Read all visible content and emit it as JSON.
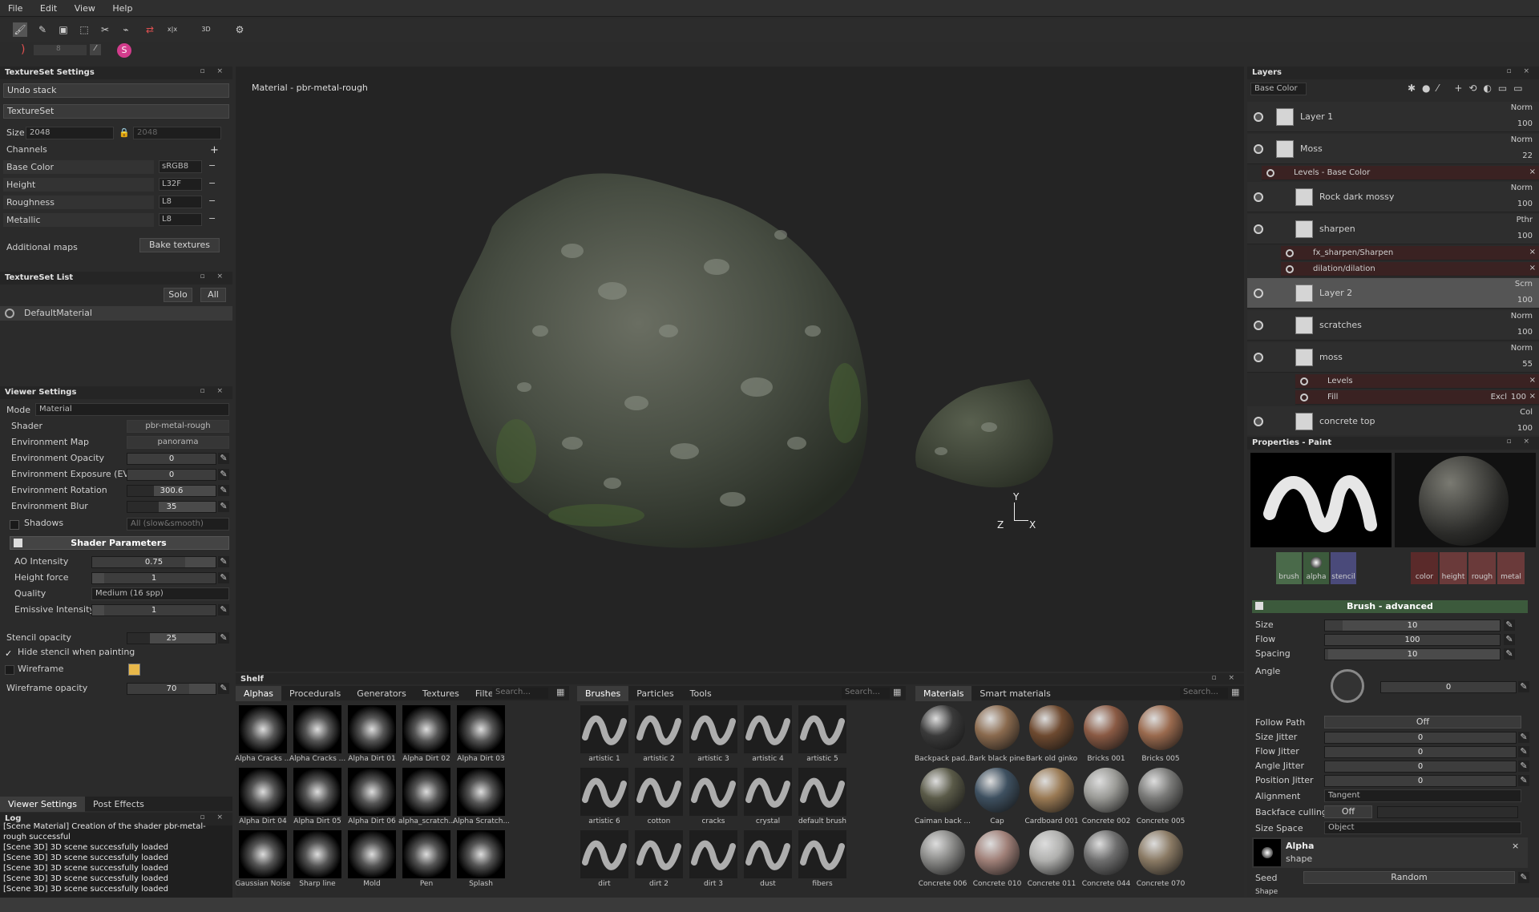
{
  "menu": [
    "File",
    "Edit",
    "View",
    "Help"
  ],
  "toolbar": {
    "tools": [
      "↖",
      "🖌",
      "✎",
      "▣",
      "⬚",
      "✂",
      "⌁",
      "⬈",
      "⇄",
      "x|x",
      "⧉",
      "3D",
      "⬈",
      "⚙"
    ],
    "size_value": "8"
  },
  "textureset_settings": {
    "title": "TextureSet Settings",
    "undo": "Undo stack",
    "textureset": "TextureSet",
    "size_label": "Size",
    "size_value": "2048",
    "size_value2": "2048",
    "channels_label": "Channels",
    "channels": [
      {
        "name": "Base Color",
        "format": "sRGB8"
      },
      {
        "name": "Height",
        "format": "L32F"
      },
      {
        "name": "Roughness",
        "format": "L8"
      },
      {
        "name": "Metallic",
        "format": "L8"
      }
    ],
    "additional_maps": "Additional maps",
    "bake": "Bake textures"
  },
  "textureset_list": {
    "title": "TextureSet List",
    "solo": "Solo",
    "all": "All",
    "item": "DefaultMaterial"
  },
  "viewer_settings": {
    "title": "Viewer Settings",
    "mode_label": "Mode",
    "mode": "Material",
    "rows": [
      {
        "label": "Shader",
        "value": "pbr-metal-rough"
      },
      {
        "label": "Environment Map",
        "value": "panorama"
      }
    ],
    "sliders": [
      {
        "label": "Environment Opacity",
        "value": "0",
        "fill": 0
      },
      {
        "label": "Environment Exposure (EV)",
        "value": "0",
        "fill": 0
      },
      {
        "label": "Environment Rotation",
        "value": "300.6",
        "fill": 0.3
      },
      {
        "label": "Environment Blur",
        "value": "35",
        "fill": 0.35
      }
    ],
    "shadows_label": "Shadows",
    "shadows_value": "All (slow&smooth)",
    "shader_params": "Shader Parameters",
    "params": [
      {
        "label": "AO Intensity",
        "value": "0.75",
        "fill": 0.75
      },
      {
        "label": "Height force",
        "value": "1",
        "fill": 0.1
      }
    ],
    "quality_label": "Quality",
    "quality_value": "Medium (16 spp)",
    "emissive_label": "Emissive Intensity",
    "emissive_value": "1",
    "stencil_label": "Stencil opacity",
    "stencil_value": "25",
    "hide_stencil": "Hide stencil when painting",
    "wireframe": "Wireframe",
    "wire_opacity_label": "Wireframe opacity",
    "wire_opacity_value": "70",
    "tabs": [
      "Viewer Settings",
      "Post Effects"
    ]
  },
  "log": {
    "title": "Log",
    "lines": [
      "[Scene Material] Creation of the shader pbr-metal-",
      "rough successful",
      "[Scene 3D] 3D scene successfully loaded",
      "[Scene 3D] 3D scene successfully loaded",
      "[Scene 3D] 3D scene successfully loaded",
      "[Scene 3D] 3D scene successfully loaded",
      "[Scene 3D] 3D scene successfully loaded"
    ]
  },
  "viewport": {
    "label": "Material - pbr-metal-rough",
    "axes": {
      "x": "X",
      "y": "Y",
      "z": "Z"
    }
  },
  "shelf": {
    "title": "Shelf",
    "tabs1": [
      "Alphas",
      "Procedurals",
      "Generators",
      "Textures",
      "Filte"
    ],
    "search": "Search...",
    "alphas": [
      "Alpha Cracks ...",
      "Alpha Cracks ...",
      "Alpha Dirt 01",
      "Alpha Dirt 02",
      "Alpha Dirt 03",
      "Alpha Dirt 04",
      "Alpha Dirt 05",
      "Alpha Dirt 06",
      "alpha_scratch...",
      "Alpha Scratch...",
      "Gaussian Noise",
      "Sharp line",
      "Mold",
      "Pen",
      "Splash"
    ],
    "tabs2": [
      "Brushes",
      "Particles",
      "Tools"
    ],
    "brushes": [
      "artistic 1",
      "artistic 2",
      "artistic 3",
      "artistic 4",
      "artistic 5",
      "artistic 6",
      "cotton",
      "cracks",
      "crystal",
      "default brush",
      "dirt",
      "dirt 2",
      "dirt 3",
      "dust",
      "fibers"
    ],
    "tabs3": [
      "Materials",
      "Smart materials"
    ],
    "materials": [
      {
        "name": "Backpack pad...",
        "color": "#3a3a3a"
      },
      {
        "name": "Bark black pine",
        "color": "#8a6a4e"
      },
      {
        "name": "Bark old ginko",
        "color": "#6e4a30"
      },
      {
        "name": "Bricks 001",
        "color": "#8a5a44"
      },
      {
        "name": "Bricks 005",
        "color": "#9a6a4e"
      },
      {
        "name": "Caiman back ...",
        "color": "#5a5a48"
      },
      {
        "name": "Cap",
        "color": "#3e5060"
      },
      {
        "name": "Cardboard 001",
        "color": "#9a7a54"
      },
      {
        "name": "Concrete 002",
        "color": "#9a9a96"
      },
      {
        "name": "Concrete 005",
        "color": "#7a7a78"
      },
      {
        "name": "Concrete 006",
        "color": "#8a8a88"
      },
      {
        "name": "Concrete 010",
        "color": "#a08078"
      },
      {
        "name": "Concrete 011",
        "color": "#b0b0ae"
      },
      {
        "name": "Concrete 044",
        "color": "#6e6e6e"
      },
      {
        "name": "Concrete 070",
        "color": "#8a7a64"
      }
    ]
  },
  "layers": {
    "title": "Layers",
    "channel": "Base Color",
    "items": [
      {
        "name": "Layer 1",
        "mode": "Norm",
        "opacity": "100"
      },
      {
        "name": "Moss",
        "mode": "Norm",
        "opacity": "22"
      },
      {
        "name": "Levels - Base Color"
      },
      {
        "name": "Rock dark mossy",
        "mode": "Norm",
        "opacity": "100"
      },
      {
        "name": "sharpen",
        "mode": "Pthr",
        "opacity": "100"
      },
      {
        "name": "fx_sharpen/Sharpen"
      },
      {
        "name": "dilation/dilation"
      },
      {
        "name": "Layer 2",
        "mode": "Scrn",
        "opacity": "100"
      },
      {
        "name": "scratches",
        "mode": "Norm",
        "opacity": "100"
      },
      {
        "name": "moss",
        "mode": "Norm",
        "opacity": "55"
      },
      {
        "name": "Levels"
      },
      {
        "name": "Fill",
        "mode": "Excl",
        "opacity": "100"
      },
      {
        "name": "concrete top",
        "mode": "Col",
        "opacity": "100"
      }
    ]
  },
  "properties": {
    "title": "Properties - Paint",
    "slots": [
      "brush",
      "alpha",
      "stencil"
    ],
    "channels": [
      "color",
      "height",
      "rough",
      "metal"
    ],
    "section": "Brush - advanced",
    "params": [
      {
        "label": "Size",
        "value": "10",
        "fill": 0.1
      },
      {
        "label": "Flow",
        "value": "100",
        "fill": 1
      },
      {
        "label": "Spacing",
        "value": "10",
        "fill": 0.02
      }
    ],
    "angle_label": "Angle",
    "angle_value": "0",
    "follow_label": "Follow Path",
    "follow_value": "Off",
    "jitters": [
      {
        "label": "Size Jitter",
        "value": "0"
      },
      {
        "label": "Flow Jitter",
        "value": "0"
      },
      {
        "label": "Angle Jitter",
        "value": "0"
      },
      {
        "label": "Position Jitter",
        "value": "0"
      }
    ],
    "alignment_label": "Alignment",
    "alignment_value": "Tangent",
    "backface_label": "Backface culling",
    "backface_value": "Off",
    "sizespace_label": "Size Space",
    "sizespace_value": "Object",
    "alpha_title": "Alpha",
    "alpha_sub": "shape",
    "seed_label": "Seed",
    "seed_value": "Random",
    "shape_label": "Shape"
  }
}
